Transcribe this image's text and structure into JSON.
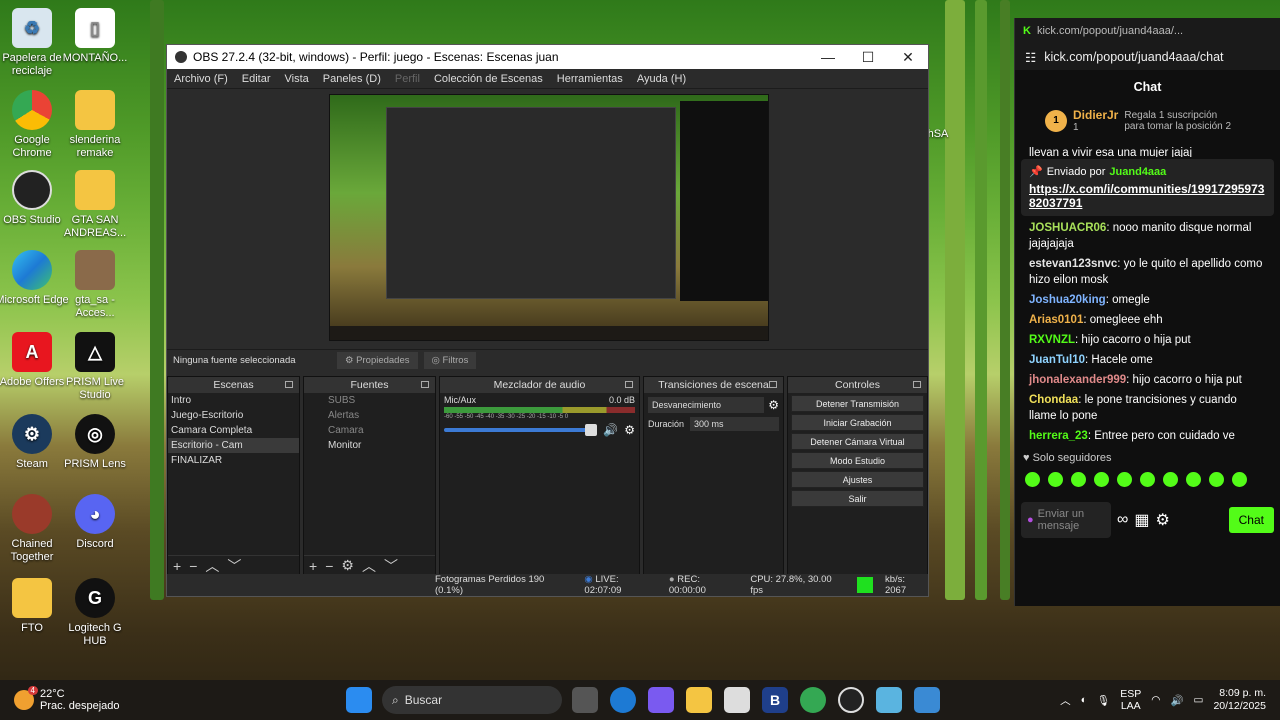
{
  "desktop": {
    "icons": [
      "Papelera de reciclaje",
      "MONTAÑO...",
      "Google Chrome",
      "slenderina remake",
      "OBS Studio",
      "GTA SAN ANDREAS...",
      "Microsoft Edge",
      "gta_sa - Acces...",
      "Adobe Offers",
      "PRISM Live Studio",
      "Steam",
      "PRISM Lens",
      "Chained Together",
      "Discord",
      "FTO",
      "Logitech G HUB"
    ],
    "partial_label": "hSA"
  },
  "obs": {
    "title": "OBS 27.2.4 (32-bit, windows) - Perfil: juego - Escenas: Escenas juan",
    "menu": [
      "Archivo (F)",
      "Editar",
      "Vista",
      "Paneles (D)",
      "Perfil",
      "Colección de Escenas",
      "Herramientas",
      "Ayuda (H)"
    ],
    "no_source": "Ninguna fuente seleccionada",
    "properties": "Propiedades",
    "filters": "Filtros",
    "docks": {
      "scenes": "Escenas",
      "sources": "Fuentes",
      "mixer": "Mezclador de audio",
      "transitions": "Transiciones de escena",
      "controls": "Controles"
    },
    "scenes": [
      "Intro",
      "Juego-Escritorio",
      "Camara Completa",
      "Escritorio - Cam",
      "FINALIZAR"
    ],
    "sources": [
      "SUBS",
      "Alertas",
      "Camara",
      "Monitor"
    ],
    "mixer": {
      "channel": "Mic/Aux",
      "db": "0.0 dB",
      "scale": "-60 -55 -50 -45 -40 -35 -30 -25 -20 -15 -10 -5 0"
    },
    "transition": {
      "type": "Desvanecimiento",
      "duration_label": "Duración",
      "duration": "300 ms"
    },
    "controls": [
      "Detener Transmisión",
      "Iniciar Grabación",
      "Detener Cámara Virtual",
      "Modo Estudio",
      "Ajustes",
      "Salir"
    ],
    "status": {
      "dropped": "Fotogramas Perdidos 190 (0.1%)",
      "live": "LIVE: 02:07:09",
      "rec": "REC: 00:00:00",
      "cpu": "CPU: 27.8%, 30.00 fps",
      "kbs": "kb/s: 2067"
    }
  },
  "kick": {
    "window_title": "kick.com/popout/juand4aaa/...",
    "url": "kick.com/popout/juand4aaa/chat",
    "chat_title": "Chat",
    "gift": {
      "rank": "1",
      "user": "DidierJr",
      "count": "1",
      "text": "Regala 1 suscripción para tomar la posición 2"
    },
    "cut_text": "llevan a vivir esa una mujer jajaj",
    "pinned": {
      "label": "Enviado por",
      "user": "Juand4aaa",
      "link": "https://x.com/i/communities/1991729597382037791"
    },
    "messages": [
      {
        "user": "JOSHUACR06",
        "color": "#a8e05a",
        "text": "nooo manito disque normal jajajajaja"
      },
      {
        "user": "estevan123snvc",
        "color": "#e5e5e5",
        "text": "yo le quito el apellido como hizo eilon mosk"
      },
      {
        "user": "Joshua20king",
        "color": "#7fb4ff",
        "text": "omegle"
      },
      {
        "user": "Arias0101",
        "color": "#f0b24a",
        "text": "omegleee ehh"
      },
      {
        "user": "RXVNZL",
        "color": "#53fc18",
        "text": "hijo cacorro o hija put"
      },
      {
        "user": "JuanTul10",
        "color": "#8fd3ff",
        "text": "Hacele ome"
      },
      {
        "user": "jhonalexander999",
        "color": "#e08a8a",
        "text": "hijo cacorro o hija put"
      },
      {
        "user": "Chondaa",
        "color": "#f0e05a",
        "text": "le pone trancisiones y cuando llame lo pone"
      },
      {
        "user": "herrera_23",
        "color": "#53fc18",
        "text": "Entree pero con cuidado ve"
      }
    ],
    "followers_only": "Solo seguidores",
    "placeholder": "Enviar un mensaje",
    "send": "Chat"
  },
  "taskbar": {
    "temp": "22°C",
    "weather": "Prac. despejado",
    "search": "Buscar",
    "lang1": "ESP",
    "lang2": "LAA",
    "time": "8:09 p. m.",
    "date": "20/12/2025",
    "badge": "4"
  }
}
